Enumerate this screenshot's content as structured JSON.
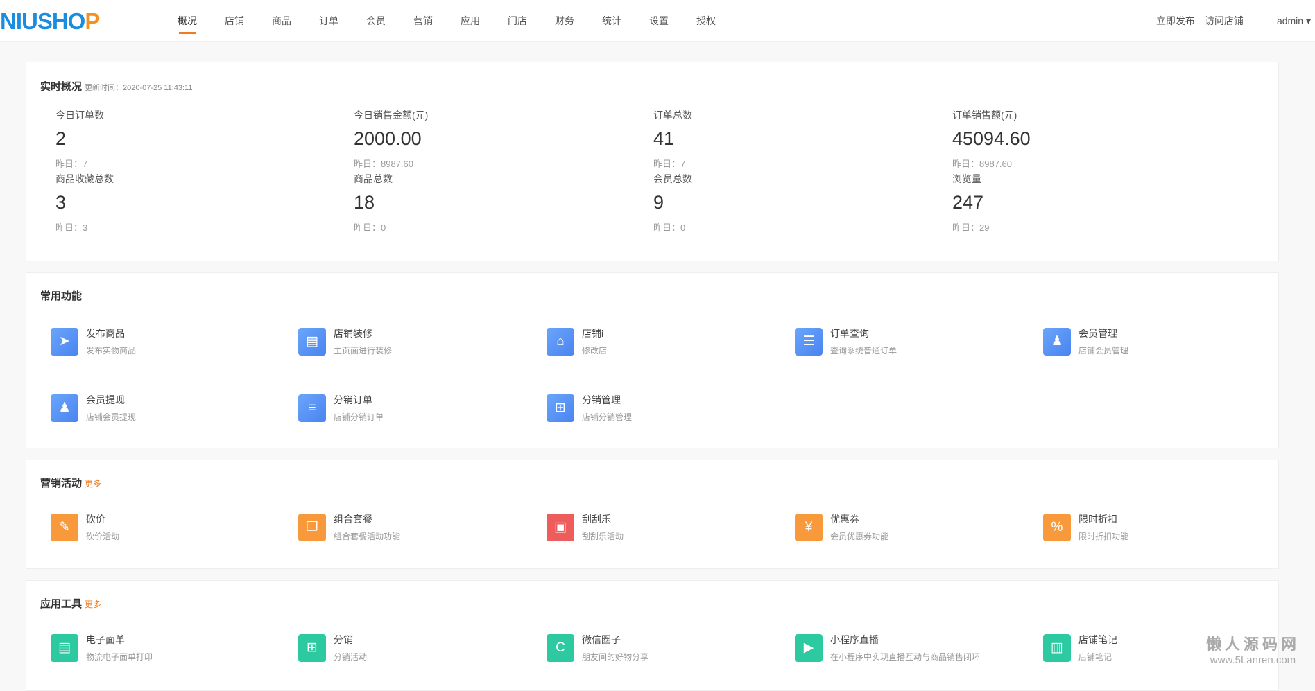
{
  "header": {
    "logo_main": "NIUSHO",
    "logo_tail": "P",
    "nav": [
      "概况",
      "店铺",
      "商品",
      "订单",
      "会员",
      "营销",
      "应用",
      "门店",
      "财务",
      "统计",
      "设置",
      "授权"
    ],
    "publish": "立即发布",
    "visit": "访问店铺",
    "user": "admin ▾"
  },
  "overview": {
    "title": "实时概况",
    "updated_label": "更新时间：2020-07-25 11:43:11",
    "stats": [
      {
        "label": "今日订单数",
        "value": "2",
        "yesterday": "昨日：7"
      },
      {
        "label": "今日销售金额(元)",
        "value": "2000.00",
        "yesterday": "昨日：8987.60"
      },
      {
        "label": "订单总数",
        "value": "41",
        "yesterday": "昨日：7"
      },
      {
        "label": "订单销售额(元)",
        "value": "45094.60",
        "yesterday": "昨日：8987.60"
      },
      {
        "label": "商品收藏总数",
        "value": "3",
        "yesterday": "昨日：3"
      },
      {
        "label": "商品总数",
        "value": "18",
        "yesterday": "昨日：0"
      },
      {
        "label": "会员总数",
        "value": "9",
        "yesterday": "昨日：0"
      },
      {
        "label": "浏览量",
        "value": "247",
        "yesterday": "昨日：29"
      }
    ]
  },
  "common": {
    "title": "常用功能",
    "items": [
      {
        "title": "发布商品",
        "desc": "发布实物商品",
        "icon": "➤"
      },
      {
        "title": "店铺装修",
        "desc": "主页面进行装修",
        "icon": "▤"
      },
      {
        "title": "店铺i",
        "desc": "修改店",
        "icon": "⌂"
      },
      {
        "title": "订单查询",
        "desc": "查询系统普通订单",
        "icon": "☰"
      },
      {
        "title": "会员管理",
        "desc": "店铺会员管理",
        "icon": "♟"
      },
      {
        "title": "会员提现",
        "desc": "店铺会员提现",
        "icon": "♟"
      },
      {
        "title": "分销订单",
        "desc": "店铺分销订单",
        "icon": "≡"
      },
      {
        "title": "分销管理",
        "desc": "店铺分销管理",
        "icon": "⊞"
      }
    ]
  },
  "marketing": {
    "title": "营销活动",
    "more": "更多",
    "items": [
      {
        "title": "砍价",
        "desc": "砍价活动",
        "icon": "✎"
      },
      {
        "title": "组合套餐",
        "desc": "组合套餐活动功能",
        "icon": "❐"
      },
      {
        "title": "刮刮乐",
        "desc": "刮刮乐活动",
        "icon": "▣"
      },
      {
        "title": "优惠券",
        "desc": "会员优惠券功能",
        "icon": "¥"
      },
      {
        "title": "限时折扣",
        "desc": "限时折扣功能",
        "icon": "%"
      }
    ]
  },
  "tools": {
    "title": "应用工具",
    "more": "更多",
    "items": [
      {
        "title": "电子面单",
        "desc": "物流电子面单打印",
        "icon": "▤"
      },
      {
        "title": "分销",
        "desc": "分销活动",
        "icon": "⊞"
      },
      {
        "title": "微信圈子",
        "desc": "朋友间的好物分享",
        "icon": "C"
      },
      {
        "title": "小程序直播",
        "desc": "在小程序中实现直播互动与商品销售闭环",
        "icon": "▶"
      },
      {
        "title": "店铺笔记",
        "desc": "店铺笔记",
        "icon": "▥"
      }
    ]
  },
  "watermark": {
    "name": "懒人源码网",
    "url": "www.5Lanren.com"
  },
  "colors": {
    "accent": "#f37b1d",
    "blue": "#4a84f0",
    "orange": "#f89a3c",
    "red": "#ee5c5c",
    "green": "#2dc9a0"
  }
}
